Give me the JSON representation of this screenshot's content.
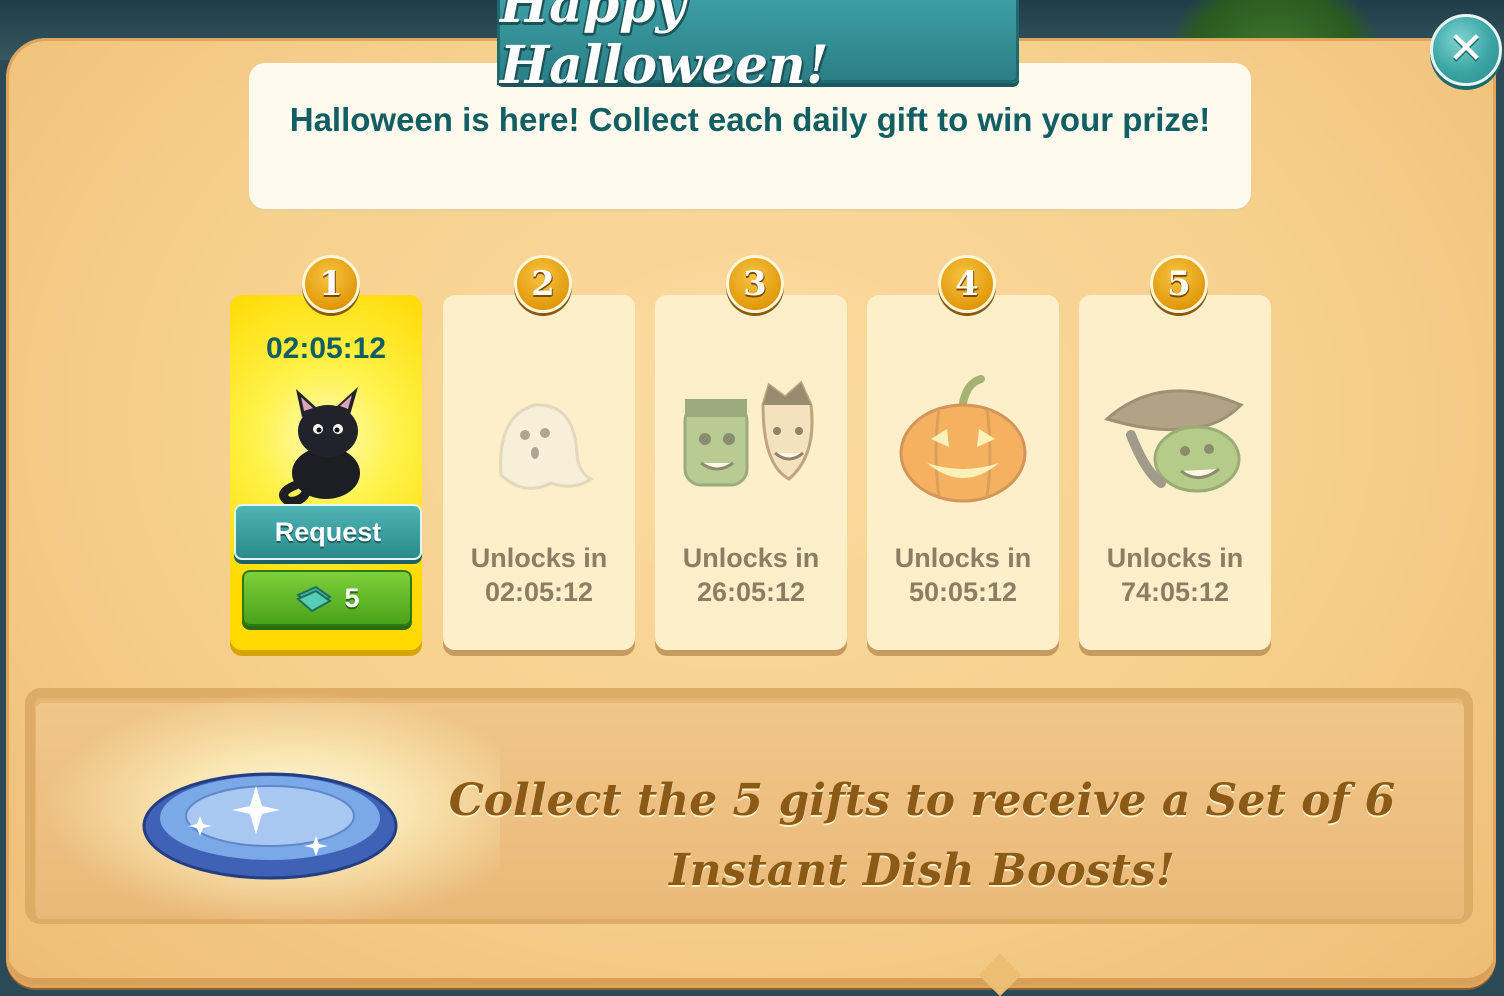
{
  "dialog": {
    "title": "Happy Halloween!",
    "close_label": "✕",
    "message": "Halloween is here! Collect each daily gift to win your prize!"
  },
  "gifts": [
    {
      "number": "1",
      "timer": "02:05:12",
      "request_label": "Request",
      "cost": "5",
      "icon": "black-cat-icon"
    },
    {
      "number": "2",
      "unlock_label": "Unlocks in",
      "unlock_time": "02:05:12",
      "icon": "ghost-icon"
    },
    {
      "number": "3",
      "unlock_label": "Unlocks in",
      "unlock_time": "26:05:12",
      "icon": "monsters-icon"
    },
    {
      "number": "4",
      "unlock_label": "Unlocks in",
      "unlock_time": "50:05:12",
      "icon": "jack-o-lantern-icon"
    },
    {
      "number": "5",
      "unlock_label": "Unlocks in",
      "unlock_time": "74:05:12",
      "icon": "witch-icon"
    }
  ],
  "reward": {
    "text": "Collect the 5 gifts to receive a Set of 6 Instant Dish Boosts!",
    "icon": "sparkling-plate-icon"
  },
  "colors": {
    "panel": "#f6cf8c",
    "accent_teal": "#2b7f86",
    "text_teal": "#135e63",
    "active_card": "#ffe31a",
    "locked_text": "#8d7d62",
    "reward_text": "#8a5a16"
  }
}
